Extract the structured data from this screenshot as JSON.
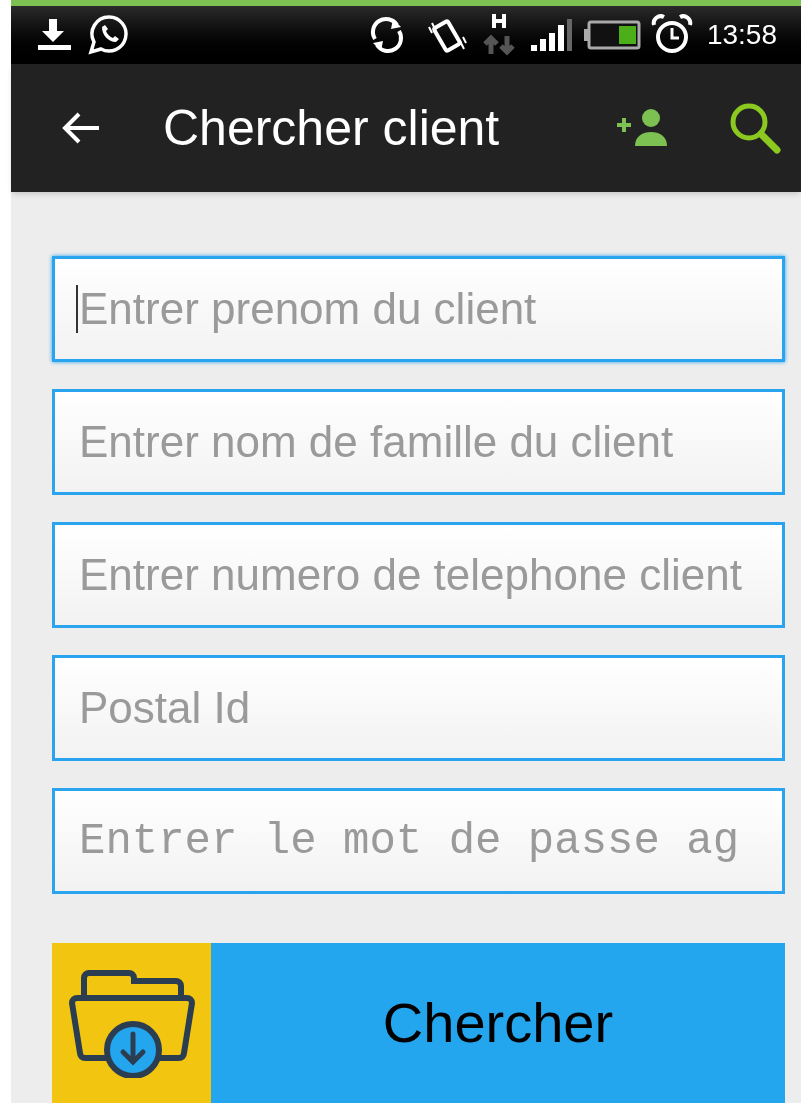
{
  "status_bar": {
    "time": "13:58"
  },
  "toolbar": {
    "title": "Chercher client"
  },
  "fields": [
    {
      "placeholder": "Entrer prenom du client",
      "kind": "text",
      "focused": true
    },
    {
      "placeholder": "Entrer nom de famille du client",
      "kind": "text",
      "focused": false
    },
    {
      "placeholder": "Entrer numero de telephone client",
      "kind": "text",
      "focused": false
    },
    {
      "placeholder": "Postal Id",
      "kind": "text",
      "focused": false
    },
    {
      "placeholder": "Entrer le mot de passe ag",
      "kind": "password",
      "focused": false
    }
  ],
  "button": {
    "label": "Chercher"
  }
}
